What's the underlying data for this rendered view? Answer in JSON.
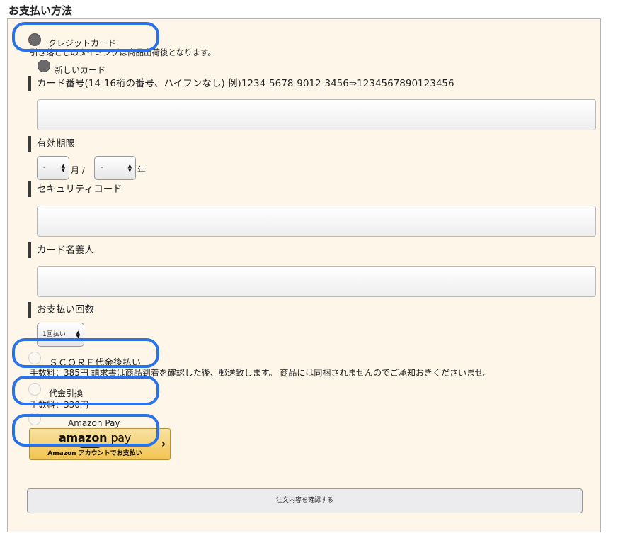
{
  "section_title": "お支払い方法",
  "credit_card": {
    "option_label": "クレジットカード",
    "note": "引き落としのタイミングは商品出荷後となります。",
    "new_card_label": "新しいカード",
    "card_number_label": "カード番号(14-16桁の番号、ハイフンなし) 例)1234-5678-9012-3456⇒1234567890123456",
    "card_number_value": "",
    "expiry_label": "有効期限",
    "month_value": "-",
    "month_suffix": "月 /",
    "year_value": "-",
    "year_suffix": "年",
    "security_code_label": "セキュリティコード",
    "security_code_value": "",
    "card_holder_label": "カード名義人",
    "card_holder_value": "",
    "installments_label": "お支払い回数",
    "installments_value": "1回払い"
  },
  "score": {
    "option_label": "ＳＣＯＲＥ代金後払い",
    "note": "手数料：385円 請求書は商品到着を確認した後、郵送致します。 商品には同梱されませんのでご承知おきくださいませ。"
  },
  "cod": {
    "option_label": "代金引換",
    "fee": "手数料：330円"
  },
  "amazon_pay": {
    "option_label": "Amazon Pay",
    "button_logo_brand": "amazon",
    "button_logo_pay": "pay",
    "button_sub": "Amazon アカウントでお支払い",
    "chevron": "›"
  },
  "confirm_button_label": "注文内容を確認する",
  "colors": {
    "panel_background": "#fff6ea",
    "highlight": "#2b72e6",
    "amazon_button": "#f2c34f"
  }
}
